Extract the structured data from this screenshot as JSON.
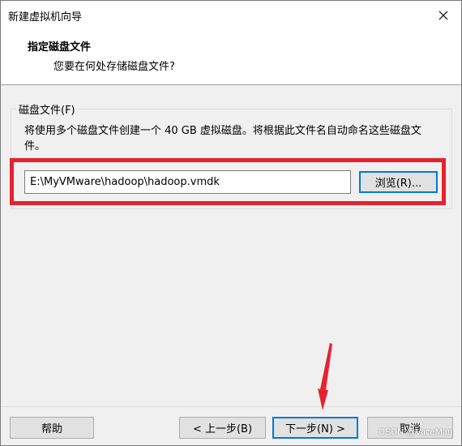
{
  "window": {
    "title": "新建虚拟机向导"
  },
  "header": {
    "title": "指定磁盘文件",
    "subtitle": "您要在何处存储磁盘文件?"
  },
  "disk_file_group": {
    "label": "磁盘文件(F)",
    "description": "将使用多个磁盘文件创建一个 40 GB 虚拟磁盘。将根据此文件名自动命名这些磁盘文件。",
    "path_value": "E:\\MyVMware\\hadoop\\hadoop.vmdk",
    "browse_label": "浏览(R)..."
  },
  "footer": {
    "help_label": "帮助",
    "back_label": "< 上一步(B)",
    "next_label": "下一步(N) >",
    "cancel_label": "取消"
  },
  "watermark": "CSDN @VaceMan",
  "colors": {
    "annotation_red": "#e8212e",
    "focus_blue": "#0078d7"
  },
  "icons": {
    "close": "close-icon"
  }
}
